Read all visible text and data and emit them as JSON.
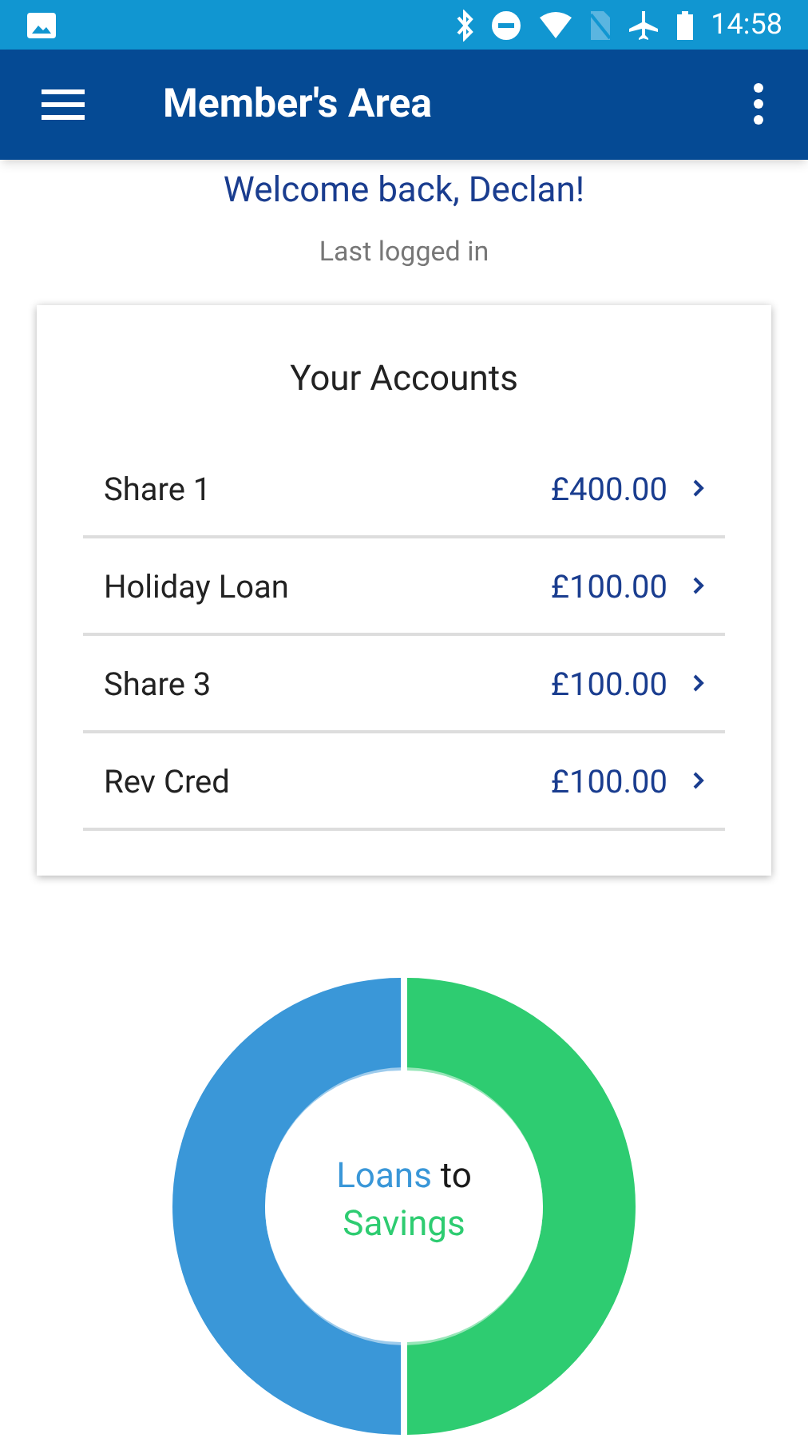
{
  "status_bar": {
    "time": "14:58"
  },
  "app_bar": {
    "title": "Member's Area"
  },
  "welcome": "Welcome back, Declan!",
  "last_login": "Last logged in",
  "accounts": {
    "title": "Your Accounts",
    "rows": [
      {
        "name": "Share 1",
        "amount": "£400.00"
      },
      {
        "name": "Holiday Loan",
        "amount": "£100.00"
      },
      {
        "name": "Share 3",
        "amount": "£100.00"
      },
      {
        "name": "Rev Cred",
        "amount": "£100.00"
      }
    ]
  },
  "donut_label": [
    {
      "text": "Loans",
      "color": "#3a97d8"
    },
    {
      "text": "to",
      "color": "#1a1a1a"
    },
    {
      "text": "Savings",
      "color": "#2ecc71"
    }
  ]
}
